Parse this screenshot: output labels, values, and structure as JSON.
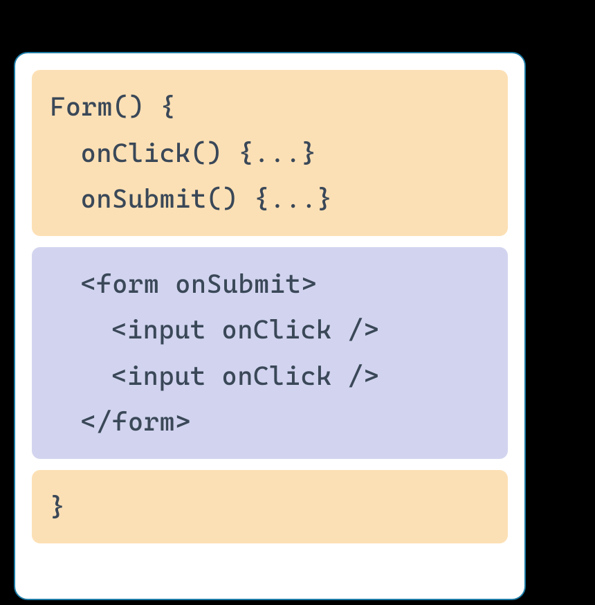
{
  "code": {
    "block1": {
      "line1": "Form() {",
      "line2": "onClick() {...}",
      "line3": "onSubmit() {...}"
    },
    "block2": {
      "line1": "<form onSubmit>",
      "line2": "<input onClick />",
      "line3": "<input onClick />",
      "line4": "</form>"
    },
    "block3": {
      "line1": "}"
    }
  },
  "colors": {
    "orange": "#fce0b5",
    "purple": "#d2d4ef",
    "border": "#1d7ca7",
    "text": "#3a4858"
  }
}
